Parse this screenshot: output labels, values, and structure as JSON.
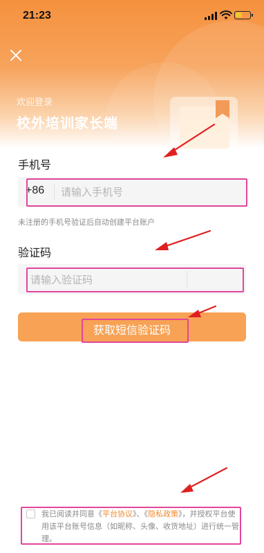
{
  "status_bar": {
    "time": "21:23"
  },
  "header": {
    "welcome": "欢迎登录",
    "title": "校外培训家长端"
  },
  "phone": {
    "label": "手机号",
    "country_code": "+86",
    "placeholder": "请输入手机号",
    "hint": "未注册的手机号验证后自动创建平台账户"
  },
  "code": {
    "label": "验证码",
    "placeholder": "请输入验证码"
  },
  "send_button": {
    "label": "获取短信验证码"
  },
  "agreement": {
    "prefix": "我已阅读并同意",
    "quote_open_1": "《",
    "link_1": "平台协议",
    "quote_close_1": "》",
    "sep": "、",
    "quote_open_2": "《",
    "link_2": "隐私政策",
    "quote_close_2": "》",
    "suffix": "，并授权平台使用该平台账号信息（如昵称、头像、收货地址）进行统一管理。",
    "checked": false
  },
  "colors": {
    "accent": "#f7a255",
    "link": "#f08a2c",
    "annotation": "#e1459c",
    "arrow": "#e02020"
  },
  "icons": {
    "close": "close-icon",
    "signal": "signal-icon",
    "wifi": "wifi-icon",
    "battery": "battery-icon",
    "bookmark": "book-illustration"
  }
}
